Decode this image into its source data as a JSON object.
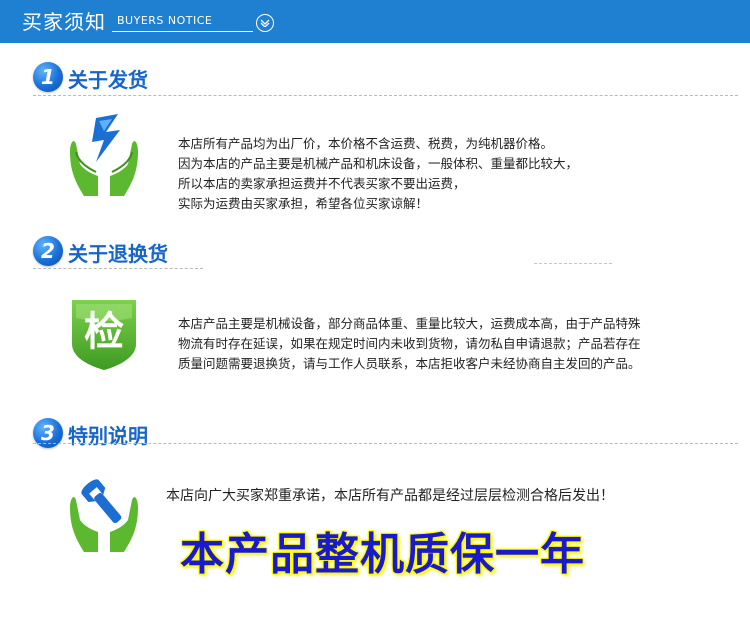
{
  "header": {
    "title_cn": "买家须知",
    "title_en": "BUYERS NOTICE"
  },
  "sections": [
    {
      "number": "1",
      "title": "关于发货",
      "icon": "lightning-hands-icon",
      "lines": [
        "本店所有产品均为出厂价，本价格不含运费、税费，为纯机器价格。",
        "因为本店的产品主要是机械产品和机床设备，一般体积、重量都比较大，",
        "所以本店的卖家承担运费并不代表买家不要出运费，",
        "实际为运费由买家承担，希望各位买家谅解！"
      ]
    },
    {
      "number": "2",
      "title": "关于退换货",
      "icon": "inspection-shield-icon",
      "icon_text": "检",
      "lines": [
        "本店产品主要是机械设备，部分商品体重、重量比较大，运费成本高，由于产品特殊",
        "物流有时存在延误，如果在规定时间内未收到货物，请勿私自申请退款；产品若存在",
        "质量问题需要退换货，请与工作人员联系，本店拒收客户未经协商自主发回的产品。"
      ]
    },
    {
      "number": "3",
      "title": "特别说明",
      "icon": "wrench-hands-icon",
      "lines": [
        "本店向广大买家郑重承诺，本店所有产品都是经过层层检测合格后发出！"
      ],
      "highlight": "本产品整机质保一年"
    }
  ],
  "colors": {
    "header_bg": "#1f7fd0",
    "title_blue": "#1665c7",
    "highlight_text": "#1a1acc",
    "highlight_glow": "#ffff00",
    "hands_green": "#5cb82e",
    "shield_green": "#4aa832"
  }
}
